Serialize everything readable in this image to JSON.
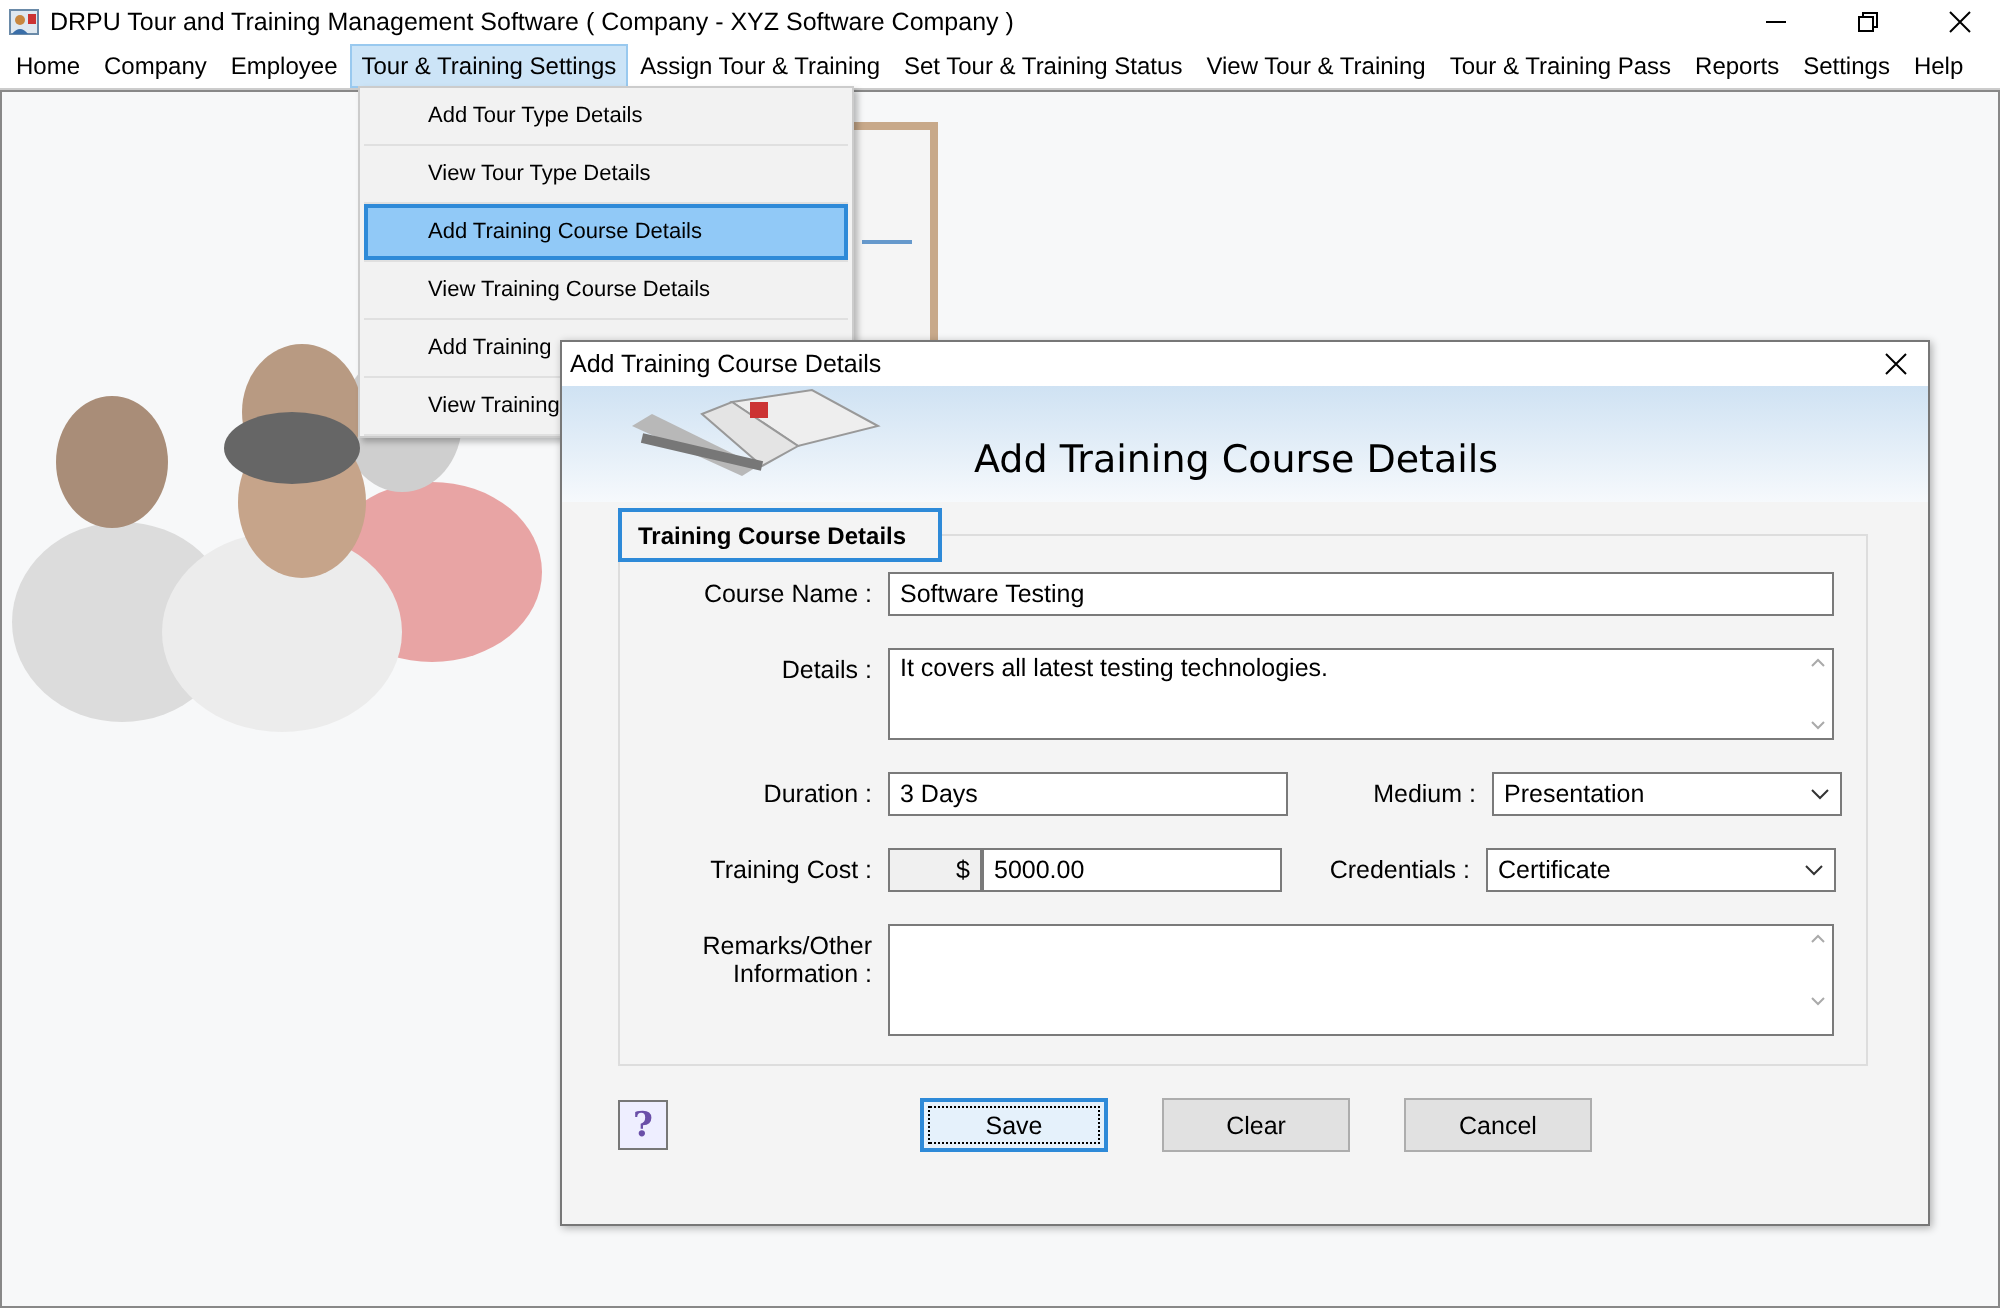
{
  "window": {
    "title": "DRPU Tour and Training Management Software  ( Company - XYZ Software Company )"
  },
  "menu_bar": [
    {
      "label": "Home",
      "selected": false
    },
    {
      "label": "Company",
      "selected": false
    },
    {
      "label": "Employee",
      "selected": false
    },
    {
      "label": "Tour & Training Settings",
      "selected": true
    },
    {
      "label": "Assign Tour & Training",
      "selected": false
    },
    {
      "label": "Set Tour & Training Status",
      "selected": false
    },
    {
      "label": "View Tour & Training",
      "selected": false
    },
    {
      "label": "Tour & Training Pass",
      "selected": false
    },
    {
      "label": "Reports",
      "selected": false
    },
    {
      "label": "Settings",
      "selected": false
    },
    {
      "label": "Help",
      "selected": false
    }
  ],
  "dropdown_menu": [
    {
      "label": "Add Tour Type Details",
      "selected": false
    },
    {
      "label": "View Tour Type Details",
      "selected": false
    },
    {
      "label": "Add Training Course Details",
      "selected": true
    },
    {
      "label": "View Training Course Details",
      "selected": false
    },
    {
      "label": "Add Training",
      "selected": false
    },
    {
      "label": "View Training",
      "selected": false
    }
  ],
  "dialog": {
    "title": "Add Training Course Details",
    "heading": "Add Training Course Details",
    "group_title": "Training Course Details",
    "rows": [
      [
        {
          "kind": "text",
          "label": "Course Name :",
          "value": "Software Testing"
        }
      ],
      [
        {
          "kind": "multiline",
          "label": "Details :",
          "value": "It covers all latest testing technologies."
        }
      ],
      [
        {
          "kind": "text",
          "label": "Duration :",
          "value": "3 Days"
        },
        {
          "kind": "dropdown",
          "label": "Medium :",
          "value": "Presentation"
        }
      ],
      [
        {
          "kind": "currency",
          "label": "Training Cost :",
          "prefix": "$",
          "value": "5000.00"
        },
        {
          "kind": "dropdown",
          "label": "Credentials :",
          "value": "Certificate"
        }
      ],
      [
        {
          "kind": "multiline",
          "label": "Remarks/Other\nInformation :"
        }
      ]
    ],
    "help_button": "?",
    "buttons": [
      {
        "label": "Save",
        "focused": true
      },
      {
        "label": "Clear",
        "focused": false
      },
      {
        "label": "Cancel",
        "focused": false
      }
    ]
  }
}
